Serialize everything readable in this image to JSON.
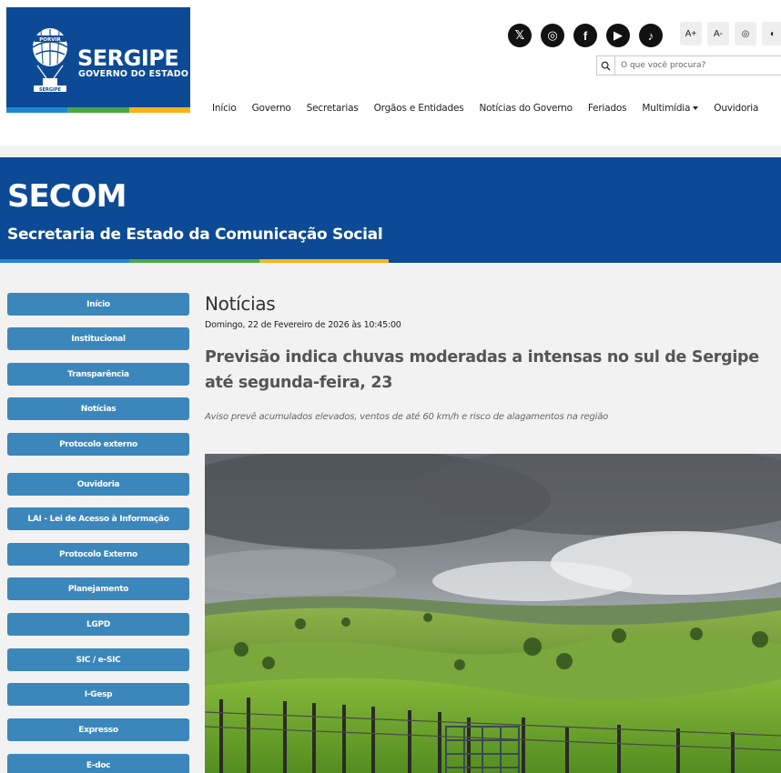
{
  "header": {
    "logo": {
      "title": "SERGIPE",
      "subtitle": "GOVERNO DO ESTADO",
      "balloon_text_top": "PORVIR",
      "balloon_text_bottom": "SERGIPE"
    },
    "stripe_colors": [
      "#1d86d0",
      "#4aa845",
      "#f6b31a"
    ],
    "socials": [
      {
        "icon": "x-icon",
        "glyph": "𝕏"
      },
      {
        "icon": "instagram-icon",
        "glyph": "◎"
      },
      {
        "icon": "facebook-icon",
        "glyph": "f"
      },
      {
        "icon": "youtube-icon",
        "glyph": "▶"
      },
      {
        "icon": "tiktok-icon",
        "glyph": "♪"
      }
    ],
    "accessibility": [
      {
        "icon": "font-increase-icon",
        "label": "A+"
      },
      {
        "icon": "font-decrease-icon",
        "label": "A-"
      },
      {
        "icon": "vlibras-icon",
        "label": "◎"
      },
      {
        "icon": "contrast-icon",
        "label": "◐"
      }
    ],
    "search": {
      "placeholder": "O que você procura?"
    },
    "nav": [
      "Início",
      "Governo",
      "Secretarias",
      "Orgãos e Entidades",
      "Notícias do Governo",
      "Feriados",
      "Multimídia",
      "Ouvidoria"
    ]
  },
  "banner": {
    "title": "SECOM",
    "subtitle": "Secretaria de Estado da Comunicação Social",
    "color": "#0c4a96"
  },
  "sidebar": {
    "color": "#3b87bb",
    "items": [
      "Início",
      "Institucional",
      "Transparência",
      "Notícias",
      "Protocolo externo",
      "Ouvidoria",
      "LAI - Lei de Acesso à Informação",
      "Protocolo Externo",
      "Planejamento",
      "LGPD",
      "SIC / e-SIC",
      "I-Gesp",
      "Expresso",
      "E-doc"
    ]
  },
  "article": {
    "section": "Notícias",
    "date": "Domingo, 22 de Fevereiro de 2026 às 10:45:00",
    "headline": "Previsão indica chuvas moderadas a intensas no sul de Sergipe até segunda-feira, 23",
    "subhead": "Aviso prevê acumulados elevados, ventos de até 60 km/h e risco de alagamentos na região"
  }
}
